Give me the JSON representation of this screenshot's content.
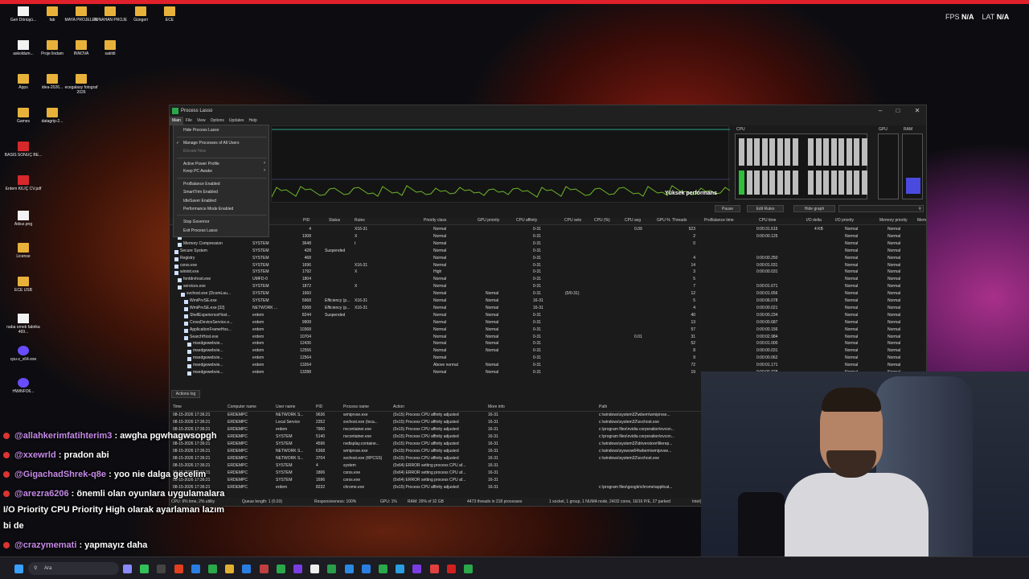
{
  "overlay": {
    "fps_label": "FPS",
    "fps_value": "N/A",
    "lat_label": "LAT",
    "lat_value": "N/A"
  },
  "desktop_icons": [
    {
      "label": "Geri Dönüşü...",
      "kind": "file"
    },
    {
      "label": "fab",
      "kind": "folder"
    },
    {
      "label": "MAYA PROJELER",
      "kind": "folder"
    },
    {
      "label": "TUNAHAN PROJE",
      "kind": "folder"
    },
    {
      "label": "Güngeri",
      "kind": "folder"
    },
    {
      "label": "ECE",
      "kind": "folder"
    },
    {
      "label": "askoldum...",
      "kind": "file"
    },
    {
      "label": "Proje lindam",
      "kind": "folder"
    },
    {
      "label": "INNOVA",
      "kind": "folder"
    },
    {
      "label": "satıldi",
      "kind": "folder"
    },
    {
      "label": "Apps",
      "kind": "folder"
    },
    {
      "label": "idea-2026...",
      "kind": "folder"
    },
    {
      "label": "ecegalasy fotograf 2026",
      "kind": "folder"
    },
    {
      "label": "Games",
      "kind": "folder"
    },
    {
      "label": "datagrip-2...",
      "kind": "folder"
    },
    {
      "label": "BASIS SONUÇ BE...",
      "kind": "pdf"
    },
    {
      "label": "Erdem KILIÇ CV.pdf",
      "kind": "pdf"
    },
    {
      "label": "Adsız.png",
      "kind": "file"
    },
    {
      "label": "License",
      "kind": "folder"
    },
    {
      "label": "ECE USB",
      "kind": "folder"
    },
    {
      "label": "naba ornek fabrika 469...",
      "kind": "file"
    },
    {
      "label": "cpu-z_x64.exe",
      "kind": "app"
    },
    {
      "label": "HWiNFO6...",
      "kind": "app"
    }
  ],
  "window": {
    "title": "Process Lasso",
    "menu": [
      "Main",
      "File",
      "View",
      "Options",
      "Updates",
      "Help"
    ],
    "graph_label": "Yüksek performans",
    "cpu_label": "CPU",
    "gpu_label": "GPU",
    "ram_label": "RAM",
    "toolbar": {
      "pause": "Pause",
      "edit_rules": "Edit Rules",
      "hide_graph": "Hide graph"
    },
    "dropdown": [
      {
        "label": "Hide Process Lasso",
        "disabled": false
      },
      {
        "label": "Manage Processes of All Users",
        "disabled": false,
        "checked": true
      },
      {
        "label": "Elevate Now",
        "disabled": true
      },
      {
        "label": "Active Power Profile",
        "disabled": false,
        "sub": true
      },
      {
        "label": "Keep PC Awake",
        "disabled": false,
        "sub": true
      },
      {
        "label": "ProBalance Enabled",
        "disabled": false
      },
      {
        "label": "SmartTrim Enabled",
        "disabled": false
      },
      {
        "label": "IdleSaver Enabled",
        "disabled": false
      },
      {
        "label": "Performance Mode Enabled",
        "disabled": false
      },
      {
        "label": "Stop Governor",
        "disabled": false
      },
      {
        "label": "Exit Process Lasso",
        "disabled": false
      }
    ],
    "columns": [
      "PID",
      "Status",
      "Rules",
      "Priority class",
      "GPU priority",
      "CPU affinity",
      "CPU sets",
      "CPU (%)",
      "CPU avg",
      "GPU %",
      "Threads",
      "ProBalance time",
      "CPU time",
      "I/O delta",
      "I/O priority",
      "Memory priority",
      "Mem"
    ],
    "processes": [
      {
        "name": "",
        "user": "",
        "pid": "4",
        "status": "",
        "rules": "X16-31",
        "prio": "Normal",
        "gpu": "",
        "aff": "0-31",
        "sets": "",
        "cpu": "",
        "avg": "0.09",
        "thr": "523",
        "time": "0:00:31.615",
        "io": "4 KB",
        "iop": "Normal",
        "memp": "Normal"
      },
      {
        "name": "smss.exe",
        "user": "SYSTEM",
        "pid": "1308",
        "status": "",
        "rules": "X",
        "prio": "Normal",
        "gpu": "",
        "aff": "0-31",
        "sets": "",
        "cpu": "",
        "avg": "",
        "thr": "2",
        "time": "0:00:00.125",
        "io": "",
        "iop": "Normal",
        "memp": "Normal"
      },
      {
        "name": "Memory Compression",
        "user": "SYSTEM",
        "pid": "3648",
        "status": "",
        "rules": "t",
        "prio": "Normal",
        "gpu": "",
        "aff": "0-31",
        "sets": "",
        "cpu": "",
        "avg": "",
        "thr": "0",
        "time": "",
        "io": "",
        "iop": "Normal",
        "memp": "Normal"
      },
      {
        "name": "Secure System",
        "user": "SYSTEM",
        "pid": "428",
        "status": "Suspended",
        "rules": "",
        "prio": "Normal",
        "gpu": "",
        "aff": "0-31",
        "sets": "",
        "cpu": "",
        "avg": "",
        "thr": "",
        "time": "",
        "io": "",
        "iop": "Normal",
        "memp": "Normal"
      },
      {
        "name": "Registry",
        "user": "SYSTEM",
        "pid": "468",
        "status": "",
        "rules": "",
        "prio": "Normal",
        "gpu": "",
        "aff": "0-31",
        "sets": "",
        "cpu": "",
        "avg": "",
        "thr": "4",
        "time": "0:00:00.250",
        "io": "",
        "iop": "Normal",
        "memp": "Normal"
      },
      {
        "name": "csrss.exe",
        "user": "SYSTEM",
        "pid": "1696",
        "status": "",
        "rules": "X16-31",
        "prio": "Normal",
        "gpu": "",
        "aff": "0-31",
        "sets": "",
        "cpu": "",
        "avg": "",
        "thr": "14",
        "time": "0:00:01.031",
        "io": "",
        "iop": "Normal",
        "memp": "Normal"
      },
      {
        "name": "wininit.exe",
        "user": "SYSTEM",
        "pid": "1792",
        "status": "",
        "rules": "X",
        "prio": "High",
        "gpu": "",
        "aff": "0-31",
        "sets": "",
        "cpu": "",
        "avg": "",
        "thr": "3",
        "time": "0:00:00.031",
        "io": "",
        "iop": "Normal",
        "memp": "Normal"
      },
      {
        "name": "fontdrvhost.exe",
        "user": "UMFD-0",
        "pid": "1804",
        "status": "",
        "rules": "",
        "prio": "Normal",
        "gpu": "",
        "aff": "0-31",
        "sets": "",
        "cpu": "",
        "avg": "",
        "thr": "5",
        "time": "",
        "io": "",
        "iop": "Normal",
        "memp": "Normal"
      },
      {
        "name": "services.exe",
        "user": "SYSTEM",
        "pid": "1872",
        "status": "",
        "rules": "X",
        "prio": "Normal",
        "gpu": "",
        "aff": "0-31",
        "sets": "",
        "cpu": "",
        "avg": "",
        "thr": "7",
        "time": "0:00:01.671",
        "io": "",
        "iop": "Normal",
        "memp": "Normal"
      },
      {
        "name": "svchost.exe (DcomLau...",
        "user": "SYSTEM",
        "pid": "1660",
        "status": "",
        "rules": "",
        "prio": "Normal",
        "gpu": "Normal",
        "aff": "0-31",
        "sets": "(0/0-31)",
        "cpu": "",
        "avg": "",
        "thr": "12",
        "time": "0:00:01.656",
        "io": "",
        "iop": "Normal",
        "memp": "Normal"
      },
      {
        "name": "WmiPrvSE.exe",
        "user": "SYSTEM",
        "pid": "5968",
        "status": "Efficiency (p...",
        "rules": "X16-31",
        "prio": "Normal",
        "gpu": "Normal",
        "aff": "16-31",
        "sets": "",
        "cpu": "",
        "avg": "",
        "thr": "5",
        "time": "0:00:06.078",
        "io": "",
        "iop": "Normal",
        "memp": "Normal"
      },
      {
        "name": "WmiPrvSE.exe [32]",
        "user": "NETWORK ...",
        "pid": "6368",
        "status": "Efficiency (p...",
        "rules": "X16-31",
        "prio": "Normal",
        "gpu": "Normal",
        "aff": "16-31",
        "sets": "",
        "cpu": "",
        "avg": "",
        "thr": "4",
        "time": "0:00:00.021",
        "io": "",
        "iop": "Normal",
        "memp": "Normal"
      },
      {
        "name": "ShellExperienceHost...",
        "user": "erdem",
        "pid": "8244",
        "status": "Suspended",
        "rules": "",
        "prio": "Normal",
        "gpu": "Normal",
        "aff": "0-31",
        "sets": "",
        "cpu": "",
        "avg": "",
        "thr": "40",
        "time": "0:00:00.234",
        "io": "",
        "iop": "Normal",
        "memp": "Normal"
      },
      {
        "name": "CrossDeviceService.e...",
        "user": "erdem",
        "pid": "9908",
        "status": "",
        "rules": "",
        "prio": "Normal",
        "gpu": "Normal",
        "aff": "0-31",
        "sets": "",
        "cpu": "",
        "avg": "",
        "thr": "13",
        "time": "0:00:00.687",
        "io": "",
        "iop": "Normal",
        "memp": "Normal"
      },
      {
        "name": "ApplicationFrameHos...",
        "user": "erdem",
        "pid": "10368",
        "status": "",
        "rules": "",
        "prio": "Normal",
        "gpu": "Normal",
        "aff": "0-31",
        "sets": "",
        "cpu": "",
        "avg": "",
        "thr": "57",
        "time": "0:00:00.156",
        "io": "",
        "iop": "Normal",
        "memp": "Normal"
      },
      {
        "name": "SearchHost.exe",
        "user": "erdem",
        "pid": "10704",
        "status": "",
        "rules": "",
        "prio": "Normal",
        "gpu": "Normal",
        "aff": "0-31",
        "sets": "",
        "cpu": "",
        "avg": "0.01",
        "thr": "31",
        "time": "0:00:02.984",
        "io": "",
        "iop": "Normal",
        "memp": "Normal"
      },
      {
        "name": "msedgewebvie...",
        "user": "erdem",
        "pid": "12436",
        "status": "",
        "rules": "",
        "prio": "Normal",
        "gpu": "Normal",
        "aff": "0-31",
        "sets": "",
        "cpu": "",
        "avg": "",
        "thr": "52",
        "time": "0:00:01.000",
        "io": "",
        "iop": "Normal",
        "memp": "Normal"
      },
      {
        "name": "msedgewebvie...",
        "user": "erdem",
        "pid": "12556",
        "status": "",
        "rules": "",
        "prio": "Normal",
        "gpu": "Normal",
        "aff": "0-31",
        "sets": "",
        "cpu": "",
        "avg": "",
        "thr": "8",
        "time": "0:00:00.031",
        "io": "",
        "iop": "Normal",
        "memp": "Normal"
      },
      {
        "name": "msedgewebvie...",
        "user": "erdem",
        "pid": "12564",
        "status": "",
        "rules": "",
        "prio": "Normal",
        "gpu": "",
        "aff": "0-31",
        "sets": "",
        "cpu": "",
        "avg": "",
        "thr": "9",
        "time": "0:00:00.062",
        "io": "",
        "iop": "Normal",
        "memp": "Normal"
      },
      {
        "name": "msedgewebvie...",
        "user": "erdem",
        "pid": "13264",
        "status": "",
        "rules": "",
        "prio": "Above normal",
        "gpu": "Normal",
        "aff": "0-31",
        "sets": "",
        "cpu": "",
        "avg": "",
        "thr": "72",
        "time": "0:00:01.171",
        "io": "",
        "iop": "Normal",
        "memp": "Normal"
      },
      {
        "name": "msedgewebvie...",
        "user": "erdem",
        "pid": "13288",
        "status": "",
        "rules": "",
        "prio": "Normal",
        "gpu": "Normal",
        "aff": "0-31",
        "sets": "",
        "cpu": "",
        "avg": "",
        "thr": "19",
        "time": "0:00:00.328",
        "io": "",
        "iop": "Normal",
        "memp": "Normal"
      }
    ],
    "log_tab": "Actions log",
    "log_columns": [
      "Time",
      "Computer name",
      "User name",
      "PID",
      "Process name",
      "Action",
      "More info",
      "Path"
    ],
    "log_rows": [
      {
        "time": "08-15-2026 17:36:21",
        "comp": "ERDEMPC",
        "user": "NETWORK S...",
        "pid": "9636",
        "proc": "wmiprvse.exe",
        "action": "(0x15) Process CPU affinity adjusted",
        "info": "16-31",
        "path": "c:\\windows\\system32\\wbem\\wmiprvse..."
      },
      {
        "time": "08-15-2026 17:36:21",
        "comp": "ERDEMPC",
        "user": "Local Service",
        "pid": "2352",
        "proc": "svchost.exe (loca...",
        "action": "(0x15) Process CPU affinity adjusted",
        "info": "16-31",
        "path": "c:\\windows\\system32\\svchost.exe"
      },
      {
        "time": "08-15-2026 17:36:21",
        "comp": "ERDEMPC",
        "user": "erdem",
        "pid": "7960",
        "proc": "nvcontainer.exe",
        "action": "(0x15) Process CPU affinity adjusted",
        "info": "16-31",
        "path": "c:\\program files\\nvidia corporation\\nvcon..."
      },
      {
        "time": "08-15-2026 17:36:21",
        "comp": "ERDEMPC",
        "user": "SYSTEM",
        "pid": "5140",
        "proc": "nvcontainer.exe",
        "action": "(0x15) Process CPU affinity adjusted",
        "info": "16-31",
        "path": "c:\\program files\\nvidia corporation\\nvcon..."
      },
      {
        "time": "08-15-2026 17:36:21",
        "comp": "ERDEMPC",
        "user": "SYSTEM",
        "pid": "4596",
        "proc": "nvdisplay.containe...",
        "action": "(0x15) Process CPU affinity adjusted",
        "info": "16-31",
        "path": "c:\\windows\\system32\\driverstore\\filerep..."
      },
      {
        "time": "08-15-2026 17:36:21",
        "comp": "ERDEMPC",
        "user": "NETWORK S...",
        "pid": "6368",
        "proc": "wmiprvse.exe",
        "action": "(0x15) Process CPU affinity adjusted",
        "info": "16-31",
        "path": "c:\\windows\\syswow64\\wbem\\wmiprvse..."
      },
      {
        "time": "08-15-2026 17:36:21",
        "comp": "ERDEMPC",
        "user": "NETWORK S...",
        "pid": "3704",
        "proc": "svchost.exe (RPCSS)",
        "action": "(0x15) Process CPU affinity adjusted",
        "info": "16-31",
        "path": "c:\\windows\\system32\\svchost.exe"
      },
      {
        "time": "08-15-2026 17:36:21",
        "comp": "ERDEMPC",
        "user": "SYSTEM",
        "pid": "4",
        "proc": "system",
        "action": "(0x64) ERROR setting process CPU af...",
        "info": "16-31",
        "path": ""
      },
      {
        "time": "08-15-2026 17:36:21",
        "comp": "ERDEMPC",
        "user": "SYSTEM",
        "pid": "1806",
        "proc": "csrss.exe",
        "action": "(0x64) ERROR setting process CPU af...",
        "info": "16-31",
        "path": ""
      },
      {
        "time": "08-15-2026 17:36:21",
        "comp": "ERDEMPC",
        "user": "SYSTEM",
        "pid": "1696",
        "proc": "csrss.exe",
        "action": "(0x64) ERROR setting process CPU af...",
        "info": "16-31",
        "path": ""
      },
      {
        "time": "08-15-2026 17:36:21",
        "comp": "ERDEMPC",
        "user": "erdem",
        "pid": "8232",
        "proc": "chrome.exe",
        "action": "(0x15) Process CPU affinity adjusted",
        "info": "16-31",
        "path": "c:\\program files\\google\\chrome\\applicat..."
      }
    ],
    "status": {
      "cpu": "CPU: 9% time, 2% utility",
      "queue": "Queue length: 1 (0.03)",
      "resp": "Responsiveness: 100%",
      "gpu": "GPU: 1%",
      "ram": "RAM: 29% of 32 GB",
      "threads": "4473 threads in 218 processes",
      "topo": "1 socket, 1 group, 1 NUMA node, 24/32 cores, 16/16 P/E, 27 parked",
      "cpuname": "Intel(R) Core(TM)"
    }
  },
  "chat": [
    {
      "user": "@allahkerimfatihterim3",
      "msg": " : awgha pgwhagwsopgh"
    },
    {
      "user": "@xxewrld",
      "msg": " : pradon abi"
    },
    {
      "user": "@GigachadShrek-q8e",
      "msg": " : yoo nie dalga gecelim"
    },
    {
      "user": "@arezra6206",
      "msg": " : önemli olan oyunlara uygulamalara"
    },
    {
      "user": "",
      "msg": "I/O Priority CPU Priority High olarak ayarlaman lazım"
    },
    {
      "user": "",
      "msg": "bi de"
    },
    {
      "user": "@crazymemati",
      "msg": " : yapmayız daha"
    }
  ],
  "taskbar": {
    "search_placeholder": "Ara"
  }
}
